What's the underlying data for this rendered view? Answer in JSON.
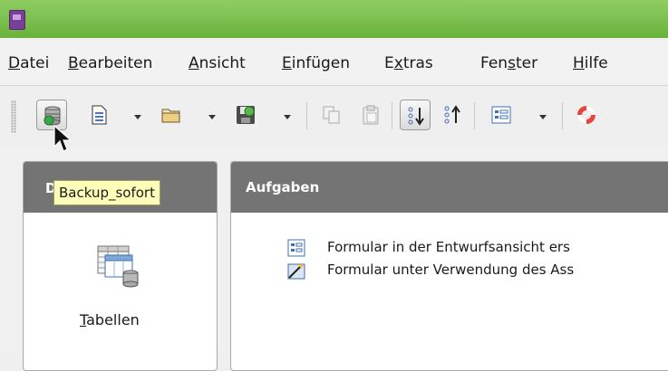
{
  "menubar": {
    "items": [
      {
        "label": "Datei"
      },
      {
        "label": "Bearbeiten"
      },
      {
        "label": "Ansicht"
      },
      {
        "label": "Einfügen"
      },
      {
        "label": "Extras"
      },
      {
        "label": "Fenster"
      },
      {
        "label": "Hilfe"
      }
    ]
  },
  "toolbar": {
    "buttons": [
      {
        "icon": "database-backup-icon",
        "pressed": true
      },
      {
        "icon": "new-document-icon",
        "has_dropdown": true
      },
      {
        "icon": "open-folder-icon",
        "has_dropdown": true
      },
      {
        "icon": "save-icon",
        "has_dropdown": true
      },
      {
        "icon": "copy-icon"
      },
      {
        "icon": "paste-icon"
      },
      {
        "icon": "sort-ascending-icon",
        "pressed": true
      },
      {
        "icon": "sort-descending-icon"
      },
      {
        "icon": "form-icon",
        "has_dropdown": true
      },
      {
        "icon": "help-lifebuoy-icon"
      }
    ]
  },
  "tooltip": {
    "text": "Backup_sofort"
  },
  "left_panel": {
    "header_letter": "D",
    "item": {
      "label_first": "T",
      "label_rest": "abellen",
      "icon": "tables-icon"
    }
  },
  "right_panel": {
    "header": "Aufgaben",
    "tasks": [
      {
        "label": "Formular in der Entwurfsansicht ers",
        "icon": "form-design-icon"
      },
      {
        "label": "Formular unter Verwendung des Ass",
        "icon": "form-wizard-icon"
      }
    ]
  },
  "colors": {
    "titlebar": "#7cc24f",
    "panel_header": "#747474",
    "tooltip_bg": "#ffffb9"
  }
}
